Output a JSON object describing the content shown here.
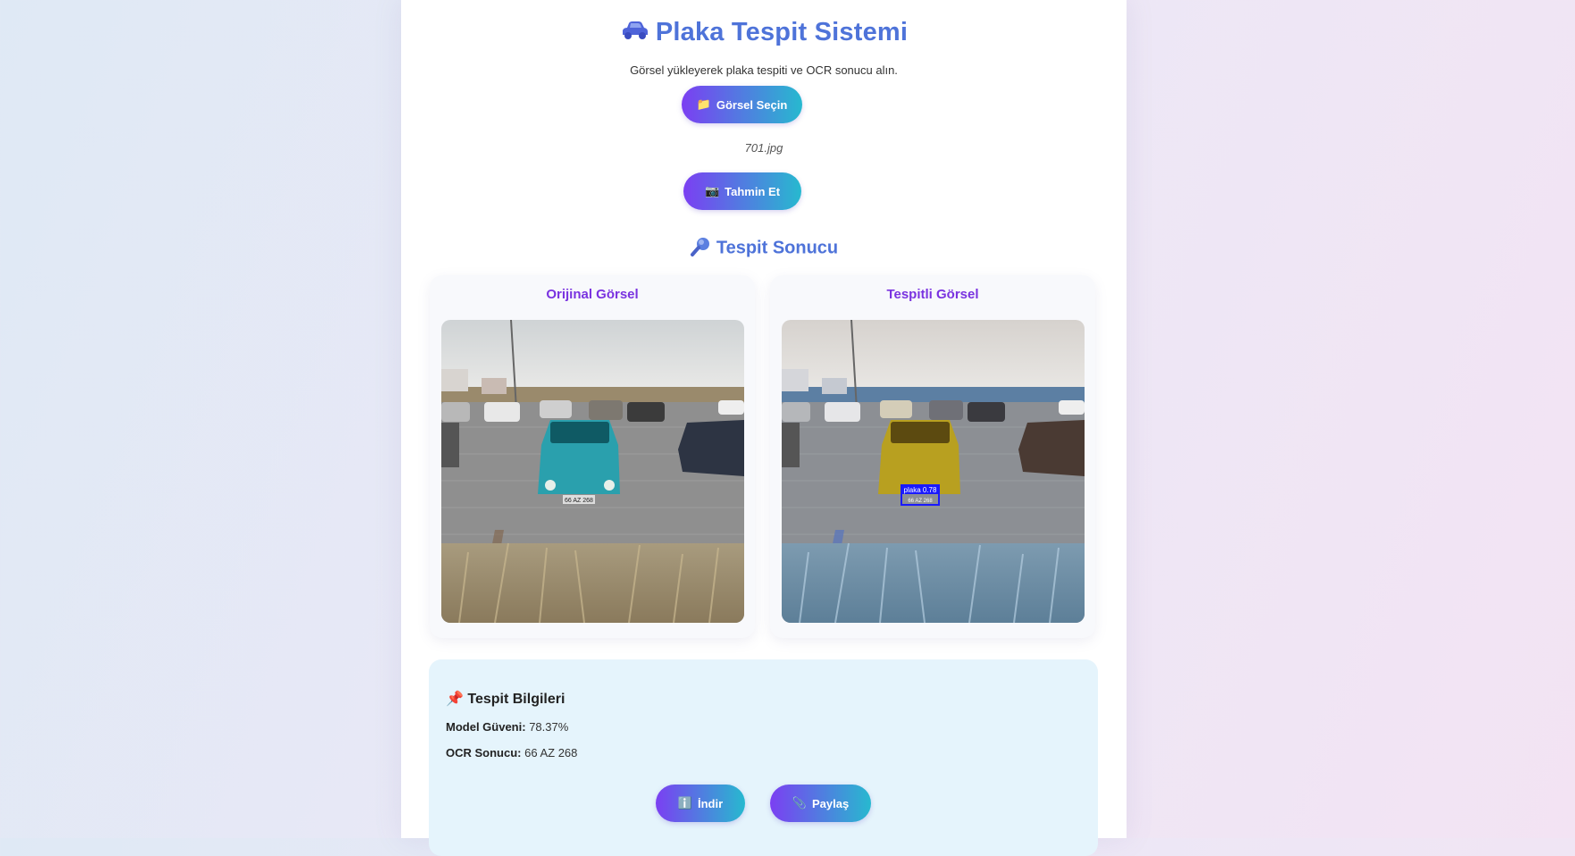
{
  "header": {
    "title": "Plaka Tespit Sistemi",
    "title_icon": "car-icon",
    "subtitle": "Görsel yükleyerek plaka tespiti ve OCR sonucu alın."
  },
  "upload": {
    "select_icon": "folder-icon",
    "select_label": "Görsel Seçin",
    "file_name": "701.jpg"
  },
  "predict": {
    "icon": "camera-icon",
    "label": "Tahmin Et"
  },
  "result": {
    "title": "Tespit Sonucu",
    "title_icon": "magnifier-icon",
    "original_title": "Orijinal Görsel",
    "detected_title": "Tespitli Görsel",
    "plate_text": "66 AZ 268",
    "detection_label": "plaka 0.78"
  },
  "info": {
    "icon": "pushpin-icon",
    "title": "Tespit Bilgileri",
    "confidence_label": "Model Güveni:",
    "confidence_value": "78.37%",
    "ocr_label": "OCR Sonucu:",
    "ocr_value": "66 AZ 268"
  },
  "actions": {
    "download_icon": "info-icon",
    "download_label": "İndir",
    "share_icon": "paperclip-icon",
    "share_label": "Paylaş"
  },
  "colors": {
    "accent_blue": "#4e73d9",
    "accent_purple": "#7a33e0",
    "button_gradient_start": "#7b3ff2",
    "button_gradient_end": "#27b9cf",
    "info_panel": "#e5f4fc",
    "detection_box": "#1a1aff"
  }
}
